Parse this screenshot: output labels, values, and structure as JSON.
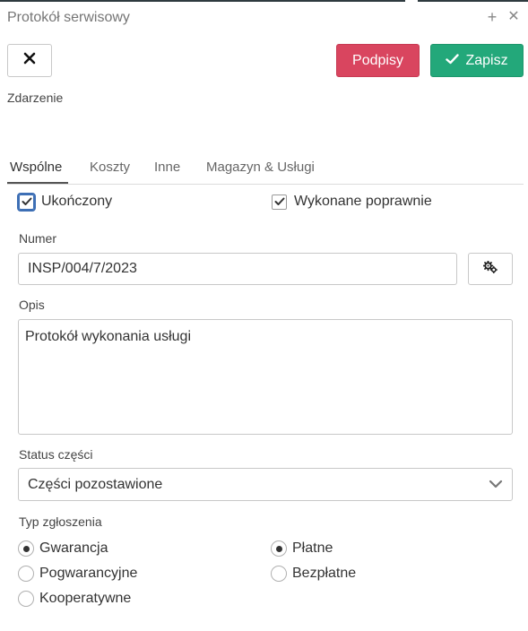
{
  "window": {
    "title": "Protokół serwisowy",
    "plus_icon": "plus-icon",
    "close_icon": "close-icon"
  },
  "toolbar": {
    "close_icon": "close-x-icon",
    "podpisy_label": "Podpisy",
    "zapisz_label": "Zapisz",
    "zapisz_icon": "check-icon",
    "colors": {
      "podpisy": "#d9455f",
      "zapisz": "#23a87a"
    }
  },
  "section": {
    "label": "Zdarzenie"
  },
  "tabs": [
    {
      "label": "Wspólne",
      "active": true
    },
    {
      "label": "Koszty",
      "active": false
    },
    {
      "label": "Inne",
      "active": false
    },
    {
      "label": "Magazyn & Usługi",
      "active": false
    }
  ],
  "checks": {
    "completed": {
      "label": "Ukończony",
      "checked": true
    },
    "done_correctly": {
      "label": "Wykonane poprawnie",
      "checked": true
    }
  },
  "numer": {
    "label": "Numer",
    "value": "INSP/004/7/2023",
    "generate_icon": "gears-icon"
  },
  "opis": {
    "label": "Opis",
    "value": "Protokół wykonania usługi"
  },
  "status": {
    "label": "Status części",
    "value": "Części pozostawione"
  },
  "typ": {
    "label": "Typ zgłoszenia",
    "left": [
      {
        "label": "Gwarancja",
        "selected": true
      },
      {
        "label": "Pogwarancyjne",
        "selected": false
      },
      {
        "label": "Kooperatywne",
        "selected": false
      }
    ],
    "right": [
      {
        "label": "Płatne",
        "selected": true
      },
      {
        "label": "Bezpłatne",
        "selected": false
      }
    ]
  }
}
